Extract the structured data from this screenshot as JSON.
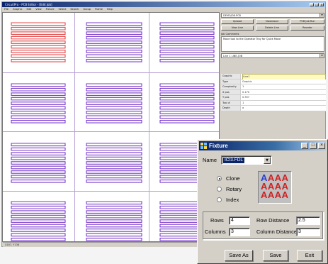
{
  "app": {
    "title": "CircuitPro - PCB Editor - [Edit Job]",
    "menu": [
      "File",
      "Graphic",
      "Edit",
      "View",
      "Fixture",
      "Select",
      "Search",
      "Group",
      "Frame",
      "Help"
    ]
  },
  "right_panel": {
    "job_combo": "DEMOJOB.PCB",
    "buttons_row1": [
      "Upload",
      "Download",
      "PCB Job Run"
    ],
    "buttons_row2": [
      "New Line",
      "Delete Line",
      "Reorder"
    ],
    "list_header": "Job Comments",
    "list_text": "Move tool to the Operator Tray for Quick Move",
    "line_combo": "Line 1 LINE-JOB",
    "properties": [
      {
        "key": "Graphic",
        "value": "Line1"
      },
      {
        "key": "Type",
        "value": "Graphic"
      },
      {
        "key": "Complexity",
        "value": "1"
      },
      {
        "key": "X pos",
        "value": "0.170"
      },
      {
        "key": "Y pos",
        "value": "0.357"
      },
      {
        "key": "Tool #",
        "value": "1"
      },
      {
        "key": "Depth",
        "value": "a"
      }
    ]
  },
  "status_text": "X187, Y138",
  "canvas": {
    "colors": {
      "red": "#e04848",
      "purple": "#7a3cc9",
      "grid": "#b9a0d8"
    }
  },
  "fixture_dialog": {
    "title": "Fixture",
    "name_label": "Name",
    "name_value": "ICI3.FDL",
    "modes": [
      {
        "label": "Clone",
        "selected": true
      },
      {
        "label": "Rotary",
        "selected": false
      },
      {
        "label": "Index",
        "selected": false
      }
    ],
    "preview_rows": [
      "AAAA",
      "AAAA",
      "AAAA"
    ],
    "rows_label": "Rows",
    "rows_value": "4",
    "columns_label": "Columns",
    "columns_value": "3",
    "row_distance_label": "Row Distance",
    "row_distance_value": "2.5",
    "column_distance_label": "Column Distance",
    "column_distance_value": "3",
    "buttons": {
      "save_as": "Save As",
      "save": "Save",
      "exit": "Exit"
    }
  }
}
